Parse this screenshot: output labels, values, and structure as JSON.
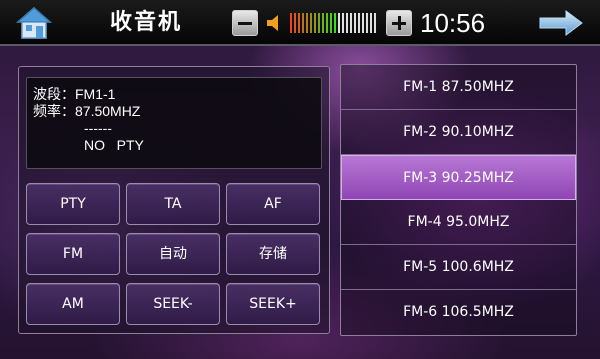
{
  "header": {
    "title": "收音机",
    "clock": "10:56",
    "volume_level": 0.55
  },
  "info": {
    "band_line": "波段：FM1-1",
    "freq_line": "频率：87.50MHZ",
    "dash_line": "------",
    "pty_line": "NO   PTY"
  },
  "buttons": [
    {
      "label": "PTY"
    },
    {
      "label": "TA"
    },
    {
      "label": "AF"
    },
    {
      "label": "FM"
    },
    {
      "label": "自动"
    },
    {
      "label": "存储"
    },
    {
      "label": "AM"
    },
    {
      "label": "SEEK-"
    },
    {
      "label": "SEEK+"
    }
  ],
  "presets": [
    {
      "label": "FM-1  87.50MHZ"
    },
    {
      "label": "FM-2  90.10MHZ"
    },
    {
      "label": "FM-3  90.25MHZ"
    },
    {
      "label": "FM-4  95.0MHZ"
    },
    {
      "label": "FM-5  100.6MHZ"
    },
    {
      "label": "FM-6  106.5MHZ"
    }
  ],
  "selected_preset": 2,
  "colors": {
    "accent": "#9046b5",
    "panel_border": "#8d7f99"
  }
}
